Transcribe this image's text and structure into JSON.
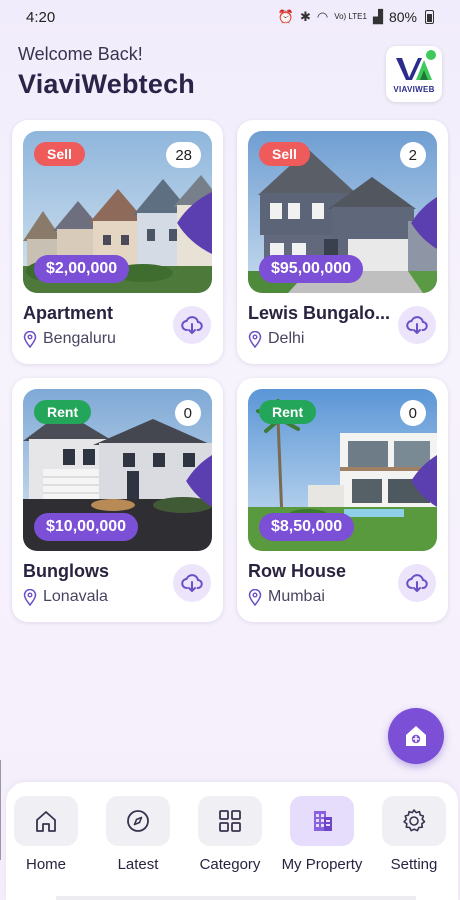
{
  "status_bar": {
    "time": "4:20",
    "network": "Vo) LTE1",
    "battery": "80%"
  },
  "header": {
    "welcome": "Welcome Back!",
    "brand": "ViaviWebtech",
    "logo_text": "VIAVIWEB"
  },
  "colors": {
    "accent": "#7b4fd6",
    "sell": "#ef5b5b",
    "rent": "#23a55a"
  },
  "properties": [
    {
      "tag": "Sell",
      "views": "28",
      "price": "$2,00,000",
      "title": "Apartment",
      "location": "Bengaluru"
    },
    {
      "tag": "Sell",
      "views": "2",
      "price": "$95,00,000",
      "title": "Lewis Bungalo...",
      "location": "Delhi"
    },
    {
      "tag": "Rent",
      "views": "0",
      "price": "$10,00,000",
      "title": "Bunglows",
      "location": "Lonavala"
    },
    {
      "tag": "Rent",
      "views": "0",
      "price": "$8,50,000",
      "title": "Row House",
      "location": "Mumbai"
    }
  ],
  "nav": {
    "items": [
      {
        "label": "Home",
        "icon": "home-icon"
      },
      {
        "label": "Latest",
        "icon": "compass-icon"
      },
      {
        "label": "Category",
        "icon": "grid-icon"
      },
      {
        "label": "My Property",
        "icon": "building-icon",
        "active": true
      },
      {
        "label": "Setting",
        "icon": "gear-icon"
      }
    ]
  },
  "fab": {
    "icon": "add-home-icon"
  }
}
